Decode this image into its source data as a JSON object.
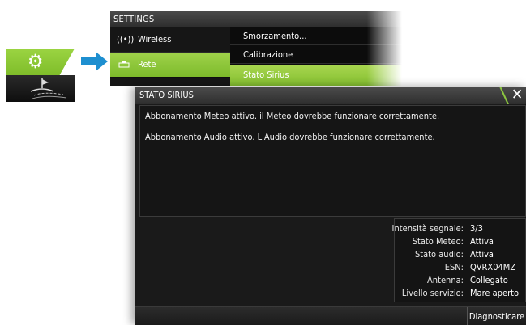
{
  "settings_menu": {
    "title": "SETTINGS",
    "items": [
      {
        "label": "Wireless",
        "icon": "wireless-icon"
      },
      {
        "label": "Rete",
        "icon": "network-icon"
      },
      {
        "label": "",
        "icon": "ais-icon"
      }
    ],
    "submenu": [
      "Smorzamento...",
      "Calibrazione",
      "Stato Sirius"
    ]
  },
  "dialog": {
    "title": "STATO SIRIUS",
    "messages": [
      "Abbonamento Meteo attivo. il Meteo dovrebbe funzionare correttamente.",
      "Abbonamento Audio attivo. L'Audio dovrebbe funzionare correttamente."
    ],
    "status": [
      {
        "label": "Intensità segnale:",
        "value": "3/3"
      },
      {
        "label": "Stato Meteo:",
        "value": "Attiva"
      },
      {
        "label": "Stato audio:",
        "value": "Attiva"
      },
      {
        "label": "ESN:",
        "value": "QVRX04MZ"
      },
      {
        "label": "Antenna:",
        "value": "Collegato"
      },
      {
        "label": "Livello servizio:",
        "value": "Mare aperto"
      }
    ],
    "diagnose_label": "Diagnosticare"
  },
  "colors": {
    "accent_green": "#8cc63f",
    "arrow_blue": "#1e8fd0",
    "panel_dark": "#1a1a1a"
  }
}
